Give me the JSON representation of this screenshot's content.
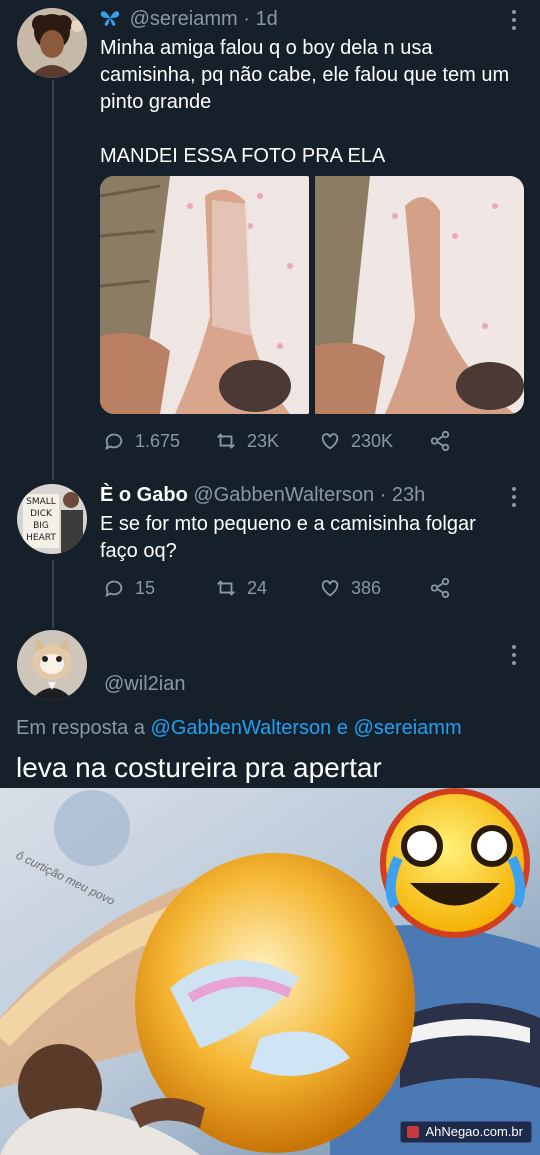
{
  "tweet1": {
    "verified_icon": "butterfly-icon",
    "handle": "@sereiamm",
    "separator": "·",
    "time": "1d",
    "text_line1": "Minha amiga falou q o boy dela n usa",
    "text_line2": "camisinha, pq não cabe, ele falou que tem um",
    "text_line3": "pinto grande",
    "text_line4": "MANDEI ESSA FOTO PRA ELA",
    "replies": "1.675",
    "retweets": "23K",
    "likes": "230K"
  },
  "tweet2": {
    "name": "È o Gabo",
    "handle": "@GabbenWalterson",
    "separator": "·",
    "time": "23h",
    "avatar_sign": [
      "SMALL",
      "DICK",
      "BIG",
      "HEART"
    ],
    "text_line1": "E se for mto pequeno e a camisinha folgar",
    "text_line2": "faço oq?",
    "replies": "15",
    "retweets": "24",
    "likes": "386"
  },
  "tweet3": {
    "handle": "@wil2ian",
    "reply_prefix": "Em resposta a",
    "reply_mention1": "@GabbenWalterson",
    "reply_conj": "e",
    "reply_mention2": "@sereiamm",
    "text": "leva na costureira pra apertar"
  },
  "meme": {
    "caption": "ô curtição meu povo",
    "watermark": "AhNegao.com.br"
  },
  "colors": {
    "background": "#15202b",
    "muted": "#8899a6",
    "link": "#1da1f2",
    "thread_line": "#38444d"
  }
}
